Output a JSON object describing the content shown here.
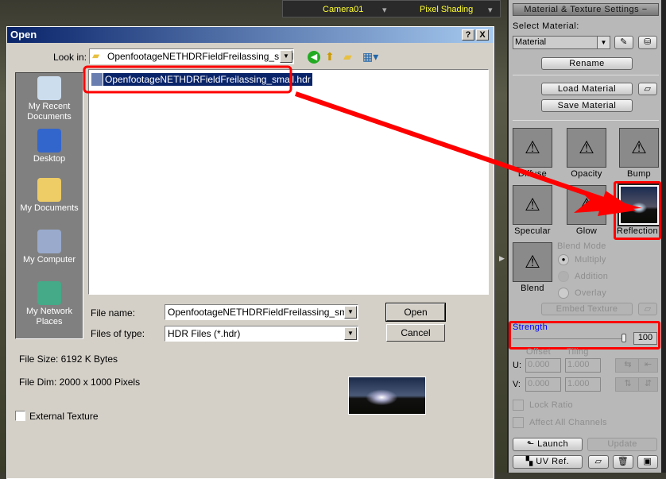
{
  "topbar": {
    "camera": "Camera01",
    "shading": "Pixel Shading"
  },
  "dialog": {
    "title": "Open",
    "help": "?",
    "close": "X",
    "look_in_label": "Look in:",
    "look_in_value": "OpenfootageNETHDRFieldFreilassing_small",
    "places": [
      {
        "label": "My Recent Documents",
        "icon": "recent-documents-icon"
      },
      {
        "label": "Desktop",
        "icon": "desktop-icon"
      },
      {
        "label": "My Documents",
        "icon": "my-documents-icon"
      },
      {
        "label": "My Computer",
        "icon": "my-computer-icon"
      },
      {
        "label": "My Network Places",
        "icon": "network-places-icon"
      }
    ],
    "files": [
      {
        "name": "OpenfootageNETHDRFieldFreilassing_small.hdr",
        "selected": true
      }
    ],
    "file_name_label": "File name:",
    "file_name_value": "OpenfootageNETHDRFieldFreilassing_small.hdr",
    "file_type_label": "Files of type:",
    "file_type_value": "HDR Files (*.hdr)",
    "open": "Open",
    "cancel": "Cancel",
    "file_size": "File Size: 6192 K Bytes",
    "file_dim": "File Dim:  2000 x 1000 Pixels",
    "external_texture": "External Texture",
    "external_texture_checked": false
  },
  "panel": {
    "header": "Material & Texture Settings",
    "collapse": "−",
    "select_material_label": "Select Material:",
    "material_value": "Material",
    "rename": "Rename",
    "load": "Load Material",
    "save": "Save Material",
    "channels": [
      "Diffuse",
      "Opacity",
      "Bump",
      "Specular",
      "Glow",
      "Reflection"
    ],
    "blend": "Blend",
    "blend_mode_label": "Blend Mode",
    "blend_modes": [
      {
        "label": "Multiply",
        "selected": true
      },
      {
        "label": "Addition",
        "selected": false
      },
      {
        "label": "Overlay",
        "selected": false
      }
    ],
    "embed": "Embed Texture",
    "strength_label": "Strength",
    "strength_value": "100",
    "strength": 100,
    "offset_label": "Offset",
    "tiling_label": "Tiling",
    "u_label": "U:",
    "v_label": "V:",
    "u_offset": "0.000",
    "u_tiling": "1.000",
    "v_offset": "0.000",
    "v_tiling": "1.000",
    "lock_ratio": "Lock Ratio",
    "affect_all": "Affect All Channels",
    "launch": "Launch",
    "update": "Update",
    "uv_ref": "UV Ref.",
    "accent": "#0000ff"
  },
  "annotation_color": "#ff0000"
}
